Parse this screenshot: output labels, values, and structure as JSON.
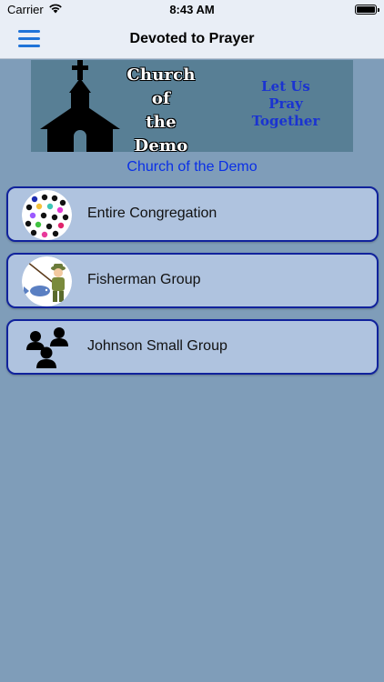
{
  "status_bar": {
    "carrier": "Carrier",
    "time": "8:43 AM",
    "battery_level": 1.0,
    "wifi_icon": "wifi-icon",
    "battery_icon": "battery-icon"
  },
  "nav": {
    "title": "Devoted to Prayer",
    "menu_icon": "hamburger-menu-icon",
    "menu_color": "#1f73d8"
  },
  "banner": {
    "title_lines": [
      "Church",
      "of",
      "the",
      "Demo"
    ],
    "tagline_lines": [
      "Let Us",
      "Pray",
      "Together"
    ],
    "background_color": "#587f95",
    "tagline_color": "#1a33d1"
  },
  "church_name": "Church of the Demo",
  "groups": [
    {
      "label": "Entire Congregation",
      "icon": "congregation-dots-icon"
    },
    {
      "label": "Fisherman Group",
      "icon": "fisherman-icon"
    },
    {
      "label": "Johnson Small Group",
      "icon": "people-group-icon"
    }
  ],
  "colors": {
    "page_background": "#7f9db9",
    "card_background": "#afc3df",
    "card_border": "#10229c",
    "church_name_color": "#0a2fe6"
  }
}
